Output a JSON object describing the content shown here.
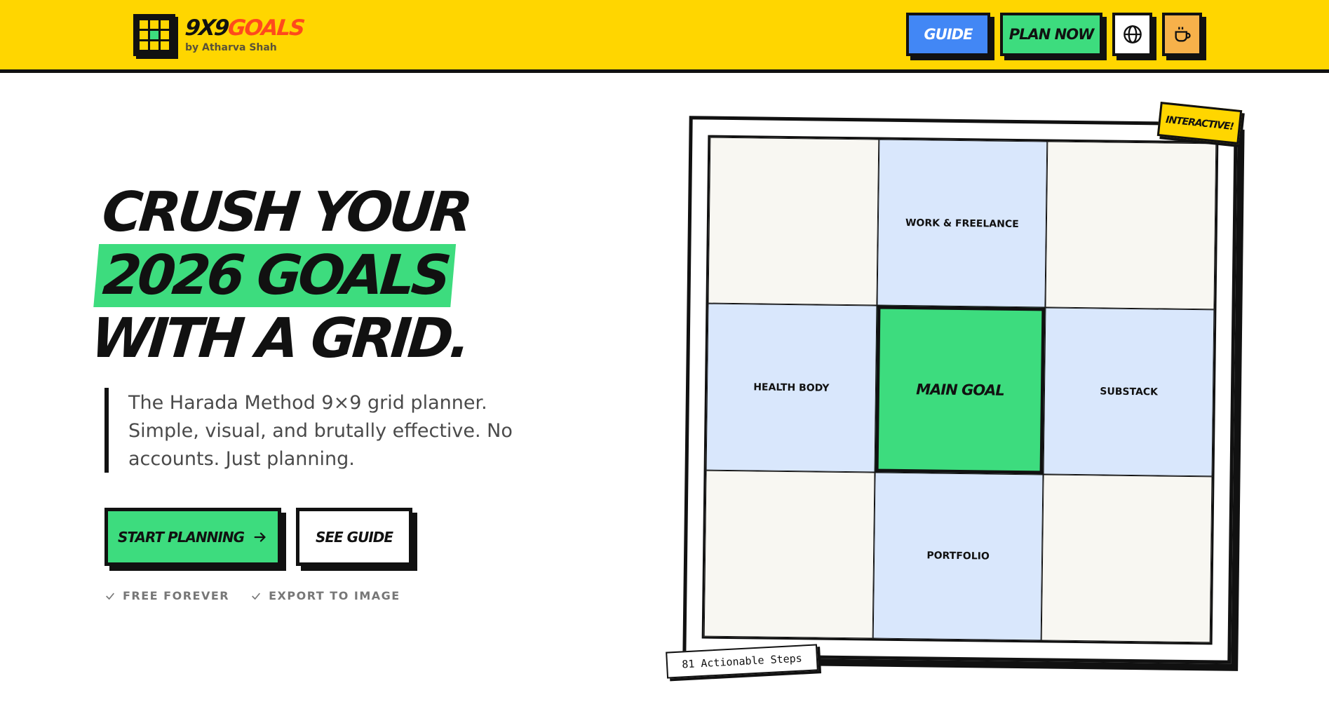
{
  "header": {
    "brand_part1": "9X9",
    "brand_part2": "GOALS",
    "byline": "by Atharva Shah",
    "guide_label": "GUIDE",
    "plan_label": "PLAN NOW",
    "language_icon": "globe-icon",
    "coffee_icon": "coffee-cup-icon"
  },
  "hero": {
    "title_line1": "CRUSH YOUR",
    "title_line2": "2026 GOALS",
    "title_line3": "WITH A GRID.",
    "description": "The Harada Method 9×9 grid planner. Simple, visual, and brutally effective. No accounts. Just planning.",
    "cta_primary": "START PLANNING",
    "cta_primary_icon": "arrow-right-icon",
    "cta_secondary": "SEE GUIDE",
    "features": [
      "FREE FOREVER",
      "EXPORT TO IMAGE"
    ],
    "feature_icon": "check-icon"
  },
  "preview": {
    "badge": "INTERACTIVE!",
    "cells": [
      "",
      "WORK & FREELANCE",
      "",
      "HEALTH BODY",
      "MAIN GOAL",
      "SUBSTACK",
      "",
      "PORTFOLIO",
      ""
    ],
    "footer_badge": "81 Actionable Steps"
  },
  "colors": {
    "header_bg": "#FFD600",
    "accent_green": "#3DDC7E",
    "accent_blue": "#4287F5",
    "accent_orange": "#FF4A1C",
    "sub_goal_bg": "#D9E7FC",
    "empty_cell_bg": "#F8F7F2",
    "coffee_bg": "#F7B14A"
  }
}
